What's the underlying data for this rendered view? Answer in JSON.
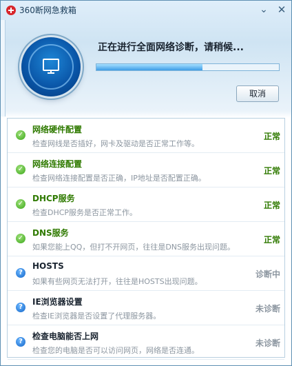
{
  "window": {
    "title": "360断网急救箱"
  },
  "titlebar": {
    "minimize_glyph": "⌄",
    "close_glyph": "✕"
  },
  "diagnosis": {
    "status_text": "正在进行全面网络诊断，请稍候...",
    "progress": 0.58,
    "cancel_label": "取消"
  },
  "colors": {
    "ok": "#2f7a00",
    "pending": "#8c96a0",
    "accent": "#3e9de6"
  },
  "checks": [
    {
      "title": "网络硬件配置",
      "desc": "检查网线是否插好，网卡及驱动是否正常工作等。",
      "state": "正常",
      "status": "ok",
      "icon": "check-icon"
    },
    {
      "title": "网络连接配置",
      "desc": "检查网络连接配置是否正确，IP地址是否配置正确。",
      "state": "正常",
      "status": "ok",
      "icon": "check-icon"
    },
    {
      "title": "DHCP服务",
      "desc": "检查DHCP服务是否正常工作。",
      "state": "正常",
      "status": "ok",
      "icon": "check-icon"
    },
    {
      "title": "DNS服务",
      "desc": "如果您能上QQ，但打不开网页，往往是DNS服务出现问题。",
      "state": "正常",
      "status": "ok",
      "icon": "check-icon"
    },
    {
      "title": "HOSTS",
      "desc": "如果有些网页无法打开，往往是HOSTS出现问题。",
      "state": "诊断中",
      "status": "pending",
      "icon": "question-icon"
    },
    {
      "title": "IE浏览器设置",
      "desc": "检查IE浏览器是否设置了代理服务器。",
      "state": "未诊断",
      "status": "pending",
      "icon": "question-icon"
    },
    {
      "title": "检查电脑能否上网",
      "desc": "检查您的电脑是否可以访问网页，网络是否连通。",
      "state": "未诊断",
      "status": "pending",
      "icon": "question-icon"
    }
  ]
}
